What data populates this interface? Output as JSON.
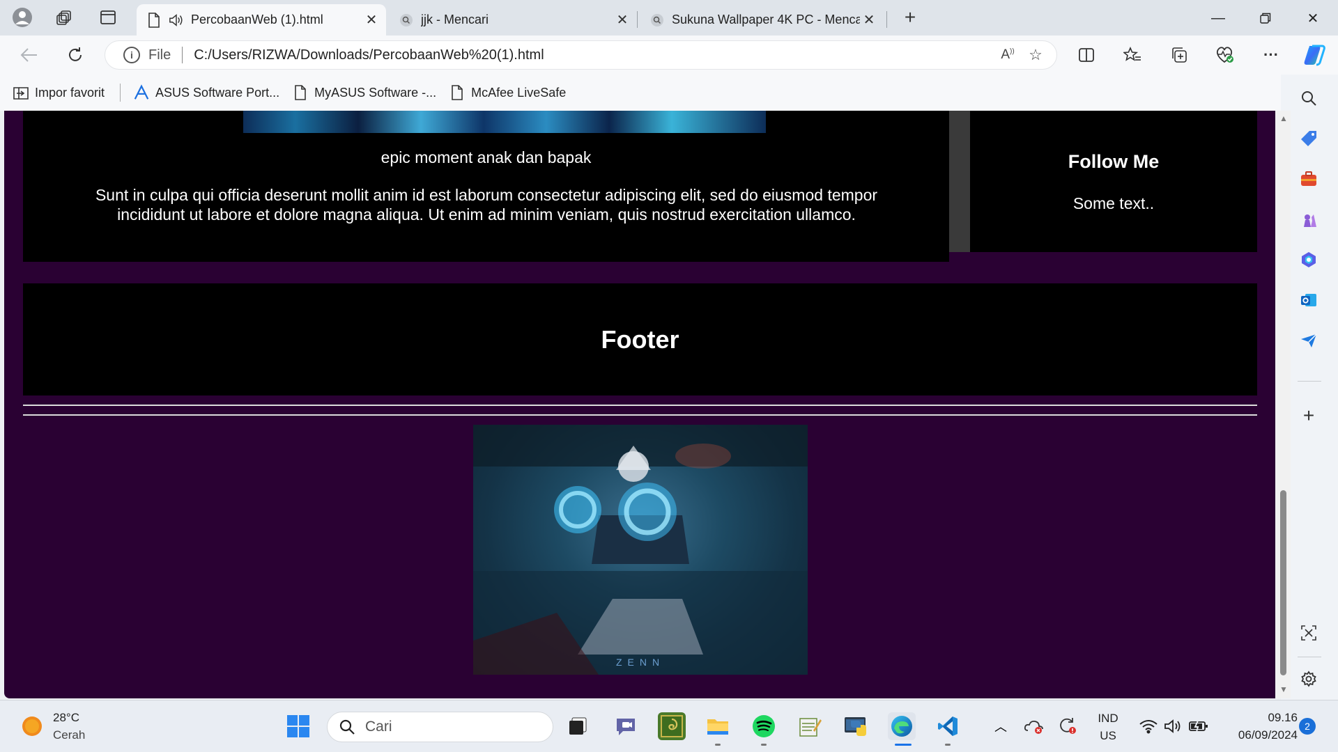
{
  "tabs": [
    {
      "title": "PercobaanWeb (1).html",
      "active": true
    },
    {
      "title": "jjk - Mencari",
      "active": false
    },
    {
      "title": "Sukuna Wallpaper 4K PC - Mencari",
      "active": false
    }
  ],
  "address": {
    "scheme_label": "File",
    "url": "C:/Users/RIZWA/Downloads/PercobaanWeb%20(1).html"
  },
  "favorites": [
    {
      "label": "Impor favorit",
      "icon": "import-favorites-icon"
    },
    {
      "label": "ASUS Software Port...",
      "icon": "asus-logo-icon"
    },
    {
      "label": "MyASUS Software -...",
      "icon": "page-icon"
    },
    {
      "label": "McAfee LiveSafe",
      "icon": "page-icon"
    }
  ],
  "page": {
    "caption": "epic moment anak dan bapak",
    "body": "Sunt in culpa qui officia deserunt mollit anim id est laborum consectetur adipiscing elit, sed do eiusmod tempor incididunt ut labore et dolore magna aliqua. Ut enim ad minim veniam, quis nostrud exercitation ullamco.",
    "side_title": "Follow Me",
    "side_text": "Some text..",
    "footer": "Footer",
    "image_watermark": "ZENN",
    "colors": {
      "background": "#2a0133",
      "panel": "#000000",
      "text": "#ffffff"
    }
  },
  "taskbar": {
    "weather": {
      "temp": "28°C",
      "condition": "Cerah"
    },
    "search_placeholder": "Cari",
    "language": {
      "line1": "IND",
      "line2": "US"
    },
    "clock": {
      "time": "09.16",
      "date": "06/09/2024"
    },
    "notification_count": "2"
  }
}
